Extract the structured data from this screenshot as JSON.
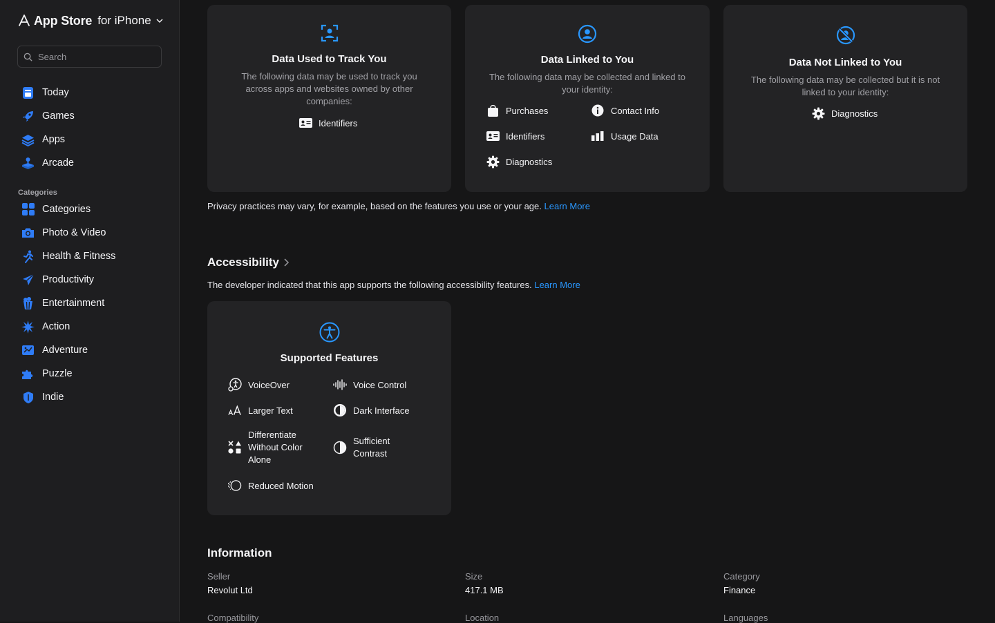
{
  "header": {
    "brand": "App Store",
    "platform": "for iPhone"
  },
  "search": {
    "placeholder": "Search"
  },
  "nav": [
    {
      "label": "Today",
      "icon": "today-icon"
    },
    {
      "label": "Games",
      "icon": "rocket-icon"
    },
    {
      "label": "Apps",
      "icon": "layers-icon"
    },
    {
      "label": "Arcade",
      "icon": "arcade-icon"
    }
  ],
  "categories": {
    "heading": "Categories",
    "items": [
      {
        "label": "Categories",
        "icon": "grid-icon"
      },
      {
        "label": "Photo & Video",
        "icon": "camera-icon"
      },
      {
        "label": "Health & Fitness",
        "icon": "running-icon"
      },
      {
        "label": "Productivity",
        "icon": "paperplane-icon"
      },
      {
        "label": "Entertainment",
        "icon": "popcorn-icon"
      },
      {
        "label": "Action",
        "icon": "burst-icon"
      },
      {
        "label": "Adventure",
        "icon": "map-icon"
      },
      {
        "label": "Puzzle",
        "icon": "puzzle-icon"
      },
      {
        "label": "Indie",
        "icon": "shield-icon"
      }
    ]
  },
  "privacy": {
    "track": {
      "title": "Data Used to Track You",
      "desc": "The following data may be used to track you across apps and websites owned by other companies:",
      "items": [
        "Identifiers"
      ]
    },
    "linked": {
      "title": "Data Linked to You",
      "desc": "The following data may be collected and linked to your identity:",
      "items": [
        "Purchases",
        "Contact Info",
        "Identifiers",
        "Usage Data",
        "Diagnostics"
      ]
    },
    "not_linked": {
      "title": "Data Not Linked to You",
      "desc": "The following data may be collected but it is not linked to your identity:",
      "items": [
        "Diagnostics"
      ]
    },
    "note": "Privacy practices may vary, for example, based on the features you use or your age.",
    "learn_more": "Learn More"
  },
  "accessibility": {
    "title": "Accessibility",
    "desc": "The developer indicated that this app supports the following accessibility features.",
    "learn_more": "Learn More",
    "card_title": "Supported Features",
    "features": [
      "VoiceOver",
      "Voice Control",
      "Larger Text",
      "Dark Interface",
      "Differentiate Without Color Alone",
      "Sufficient Contrast",
      "Reduced Motion"
    ]
  },
  "information": {
    "title": "Information",
    "rows": [
      {
        "label": "Seller",
        "value": "Revolut Ltd"
      },
      {
        "label": "Size",
        "value": "417.1 MB"
      },
      {
        "label": "Category",
        "value": "Finance"
      },
      {
        "label": "Compatibility",
        "value": ""
      },
      {
        "label": "Location",
        "value": ""
      },
      {
        "label": "Languages",
        "value": ""
      }
    ]
  },
  "colors": {
    "accent": "#2997ff",
    "background": "#161617",
    "sidebar": "#1e1e20",
    "card": "#232325"
  }
}
